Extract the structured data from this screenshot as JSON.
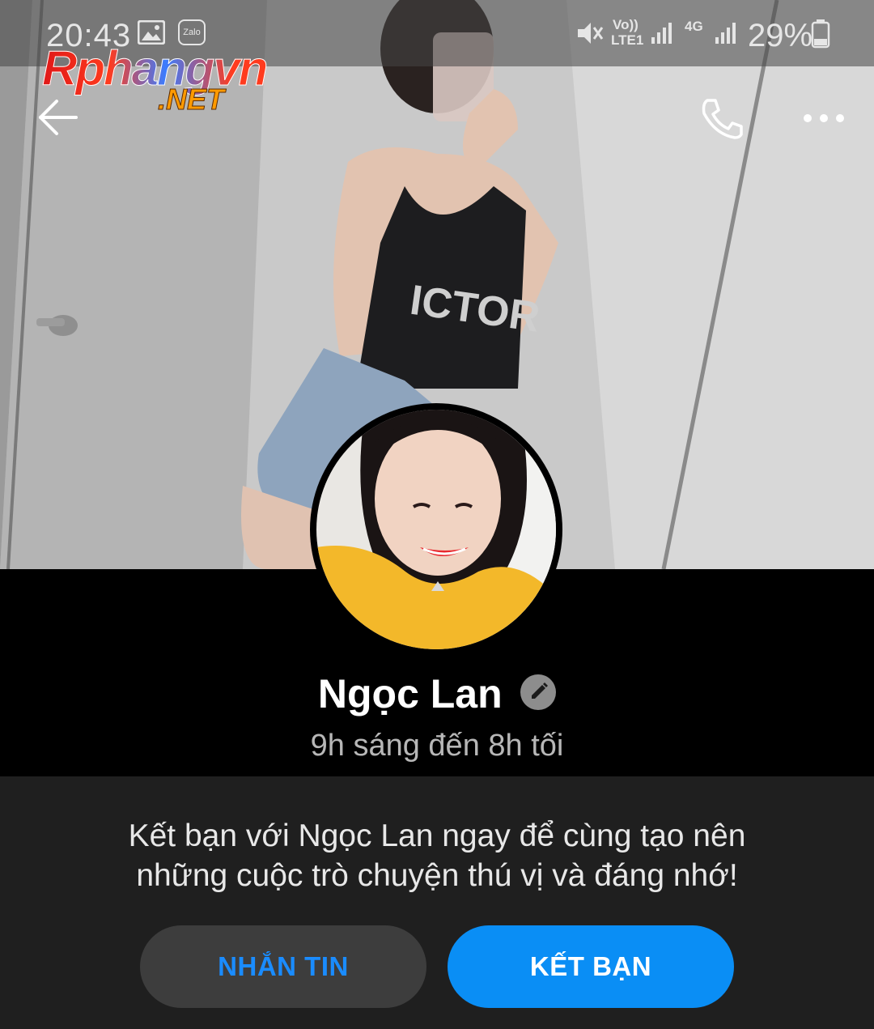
{
  "status_bar": {
    "time": "20:43",
    "app_badge": "Zalo",
    "network_labels": [
      "Vo))",
      "LTE1",
      "4G"
    ],
    "battery": "29%"
  },
  "watermark": {
    "main": "Rphangvn",
    "suffix": ".NET"
  },
  "profile": {
    "name": "Ngọc Lan",
    "hours": "9h sáng đến 8h tối"
  },
  "prompt": {
    "line1": "Kết bạn với Ngọc Lan ngay để cùng tạo nên",
    "line2": "những cuộc trò chuyện thú vị và đáng nhớ!"
  },
  "actions": {
    "message_label": "NHẮN TIN",
    "add_friend_label": "KẾT BẠN"
  },
  "colors": {
    "accent": "#0a8ef5",
    "message_text": "#1a8cff",
    "panel_bg": "#1f1f1f"
  },
  "icons": [
    "back-arrow-icon",
    "phone-icon",
    "more-icon",
    "edit-icon",
    "gallery-icon",
    "mute-icon",
    "signal-icon",
    "battery-icon"
  ]
}
